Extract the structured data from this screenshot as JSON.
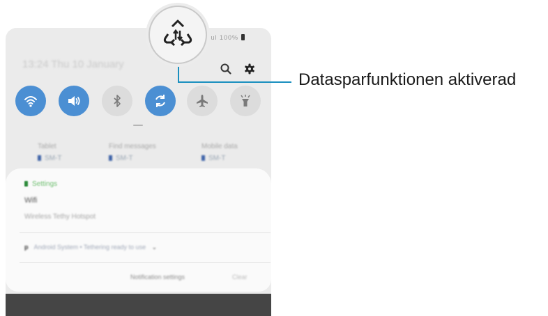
{
  "header": {
    "date_time": "13:24 Thu 10 January",
    "status_icons": "ul ul 100%",
    "search_icon": "search-icon",
    "settings_icon": "gear-icon"
  },
  "quick_settings": [
    {
      "name": "wifi",
      "icon": "wifi-icon",
      "state": "on"
    },
    {
      "name": "sound",
      "icon": "volume-icon",
      "state": "on"
    },
    {
      "name": "bluetooth",
      "icon": "bluetooth-icon",
      "state": "off"
    },
    {
      "name": "data-saver",
      "icon": "sync-icon",
      "state": "on"
    },
    {
      "name": "airplane",
      "icon": "airplane-icon",
      "state": "off"
    },
    {
      "name": "flashlight",
      "icon": "flashlight-icon",
      "state": "off"
    }
  ],
  "media_output": [
    {
      "label": "Tablet",
      "sub": "SM-T"
    },
    {
      "label": "Find messages",
      "sub": "SM-T"
    },
    {
      "label": "Mobile data",
      "sub": "SM-T"
    }
  ],
  "notification": {
    "app": "Settings",
    "title": "Wifi",
    "body": "Wireless Tethy Hotspot",
    "secondary": "Android System  •  Tethering ready to use",
    "settings_label": "Notification settings",
    "clear_label": "Clear"
  },
  "callout": {
    "label": "Datasparfunktionen aktiverad",
    "icon": "data-saver-icon"
  },
  "colors": {
    "accent": "#4b8fd3",
    "panel": "#ebebeb",
    "card": "#fafafa",
    "nav": "#454545",
    "callout_line": "#1a8fbf"
  }
}
